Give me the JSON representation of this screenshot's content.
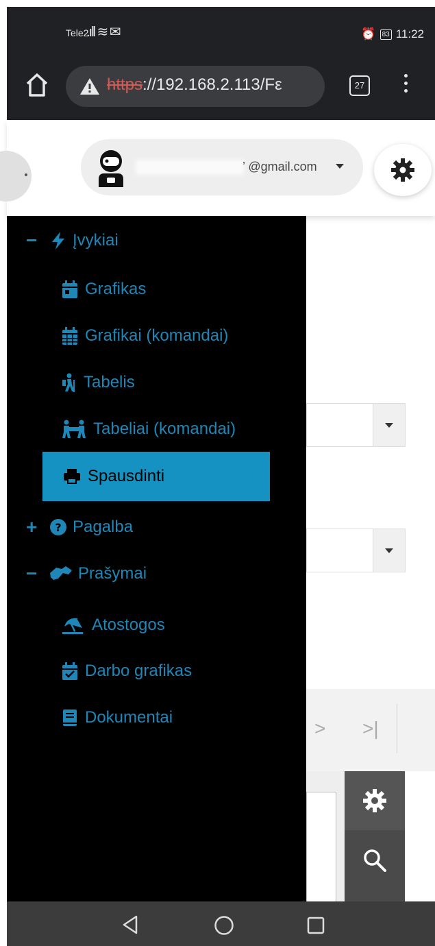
{
  "status_bar": {
    "carrier": "Tele2",
    "battery": "83",
    "time": "11:22"
  },
  "browser": {
    "url_protocol": "https",
    "url_rest": "://192.168.2.113/Fε",
    "tab_count": "27"
  },
  "header": {
    "email_visible": "’ @gmail.com"
  },
  "drawer": {
    "sections": [
      {
        "label": "Įvykiai",
        "expander": "−",
        "icon": "bolt-icon"
      },
      {
        "label": "Pagalba",
        "expander": "+",
        "icon": "question-circle-icon"
      },
      {
        "label": "Prašymai",
        "expander": "−",
        "icon": "handshake-icon"
      }
    ],
    "items": [
      {
        "label": "Grafikas",
        "icon": "calendar-day-icon"
      },
      {
        "label": "Grafikai (komandai)",
        "icon": "calendar-grid-icon"
      },
      {
        "label": "Tabelis",
        "icon": "hiking-icon"
      },
      {
        "label": "Tabeliai (komandai)",
        "icon": "people-carry-icon"
      },
      {
        "label": "Spausdinti",
        "icon": "print-icon",
        "active": true
      },
      {
        "label": "Atostogos",
        "icon": "umbrella-beach-icon"
      },
      {
        "label": "Darbo grafikas",
        "icon": "calendar-check-icon"
      },
      {
        "label": "Dokumentai",
        "icon": "book-icon"
      }
    ]
  },
  "colors": {
    "accent": "#1e87b8",
    "active_bg": "#1592c2",
    "drawer_bg": "#000000",
    "system_bar": "#202124"
  }
}
